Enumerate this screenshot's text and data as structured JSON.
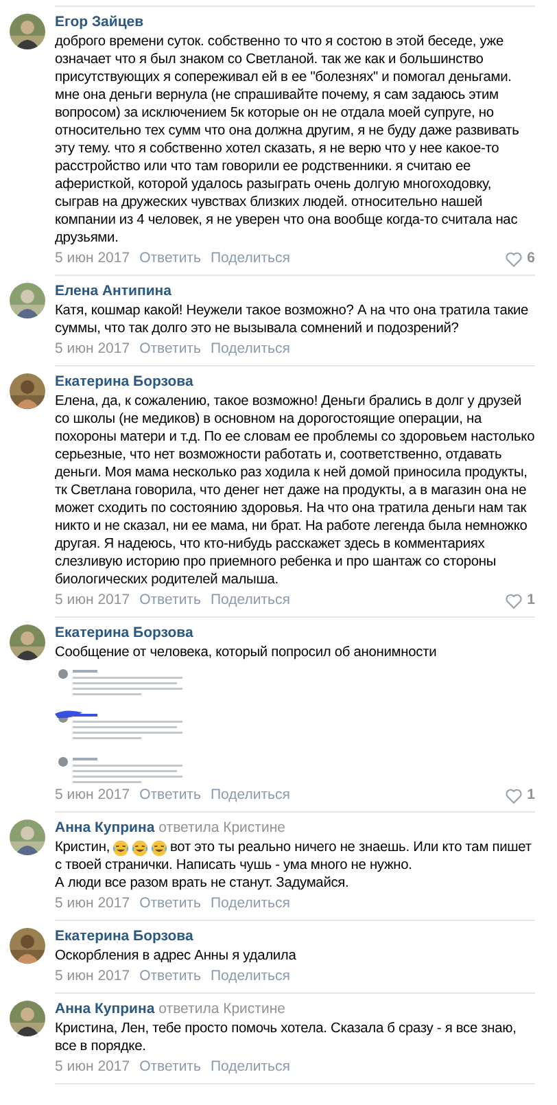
{
  "comments": [
    {
      "author": "Егор Зайцев",
      "segments": [
        {
          "kind": "paragraph",
          "text": "доброго времени суток. собственно то что я состою в этой беседе, уже означает что я был знаком со Светланой. так же как и большинство присутствующих я сопереживал ей в ее \"болезнях\" и помогал деньгами. мне она деньги вернула (не спрашивайте почему, я сам задаюсь этим вопросом) за исключением 5к которые он не отдала моей супруге, но относительно тех сумм что она должна другим, я не буду даже развивать эту тему. что я собственно хотел сказать, я не верю что у нее какое-то расстройство или что там говорили ее родственники. я считаю ее аферисткой, которой удалось разыграть очень долгую многоходовку, сыграв на дружеских чувствах близких людей. относительно нашей компании из 4 человек, я не уверен что она вообще когда-то считала нас друзьями."
        }
      ],
      "date": "5 июн 2017",
      "reply": "Ответить",
      "share": "Поделиться",
      "likes": "6"
    },
    {
      "author": "Елена Антипина",
      "segments": [
        {
          "kind": "paragraph",
          "text": "Катя, кошмар какой! Неужели такое возможно? А на что она тратила такие суммы, что так долго это не вызывала сомнений и подозрений?"
        }
      ],
      "date": "5 июн 2017",
      "reply": "Ответить",
      "share": "Поделиться"
    },
    {
      "author": "Екатерина Борзова",
      "segments": [
        {
          "kind": "paragraph",
          "text": "Елена, да, к сожалению, такое возможно! Деньги брались в долг у друзей со школы (не медиков) в основном на дорогостоящие операции, на похороны матери и т.д. По ее словам ее проблемы со здоровьем настолько серьезные, что нет возможности работать и, соответственно, отдавать деньги. Моя мама несколько раз ходила к ней домой приносила продукты, тк Светлана говорила, что денег нет даже на продукты, а в магазин она не может сходить по состоянию здоровья. На что она тратила деньги нам так никто и не сказал, ни ее мама, ни брат. На работе легенда была немножко другая. Я надеюсь, что кто-нибудь расскажет здесь в комментариях слезливую историю про приемного ребенка и про шантаж со стороны биологических родителей малыша."
        }
      ],
      "date": "5 июн 2017",
      "reply": "Ответить",
      "share": "Поделиться",
      "likes": "1"
    },
    {
      "author": "Екатерина Борзова",
      "segments": [
        {
          "kind": "paragraph",
          "text": "Сообщение от человека, который попросил об анонимности"
        }
      ],
      "date": "5 июн 2017",
      "reply": "Ответить",
      "share": "Поделиться",
      "likes": "1"
    },
    {
      "author": "Анна Куприна",
      "replied_to": "ответила Кристине",
      "segments": [
        {
          "kind": "text",
          "text": "Кристин,"
        },
        {
          "kind": "emoji"
        },
        {
          "kind": "emoji"
        },
        {
          "kind": "emoji"
        },
        {
          "kind": "text",
          "text": "вот это ты реально ничего не знаешь. Или кто там пишет"
        },
        {
          "kind": "paragraph",
          "text": "с твоей странички. Написать чушь - ума много не нужно.\nА люди все разом врать не станут. Задумайся."
        }
      ],
      "date": "5 июн 2017",
      "reply": "Ответить",
      "share": "Поделиться"
    },
    {
      "author": "Екатерина Борзова",
      "segments": [
        {
          "kind": "paragraph",
          "text": "Оскорбления в адрес Анны я удалила"
        }
      ],
      "date": "5 июн 2017",
      "reply": "Ответить",
      "share": "Поделиться"
    },
    {
      "author": "Анна Куприна",
      "replied_to": "ответила Кристине",
      "segments": [
        {
          "kind": "paragraph",
          "text": "Кристина, Лен, тебе просто помочь хотела. Сказала б сразу - я все знаю, все в порядке."
        }
      ],
      "date": "5 июн 2017",
      "reply": "Ответить",
      "share": "Поделиться"
    }
  ]
}
